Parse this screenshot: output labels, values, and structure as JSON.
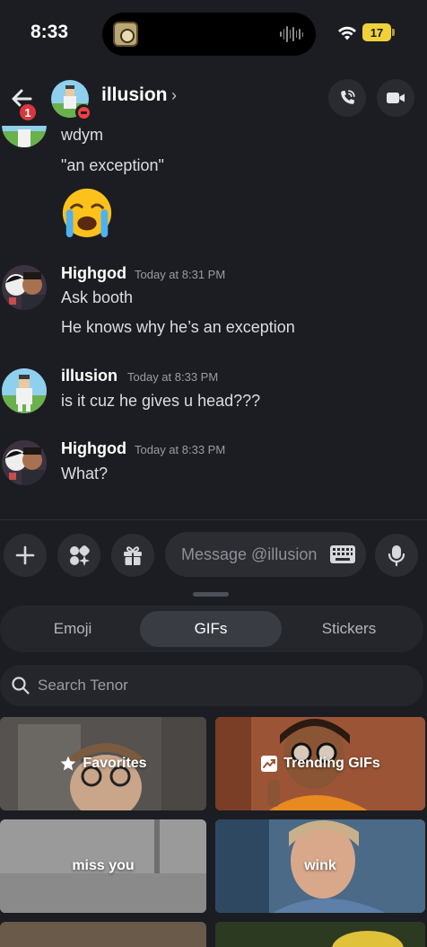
{
  "status_bar": {
    "time": "8:33",
    "battery": "17"
  },
  "header": {
    "title": "illusion",
    "chevron": "›",
    "back_badge": "1"
  },
  "messages": {
    "partial": {
      "line1": "wdym",
      "line2": "\"an exception\""
    },
    "group1": {
      "author": "Highgod",
      "timestamp": "Today at 8:31 PM",
      "line1": "Ask booth",
      "line2": "He knows why he’s an exception"
    },
    "group2": {
      "author": "illusion",
      "timestamp": "Today at 8:33 PM",
      "line1": "is it cuz he gives u head???"
    },
    "group3": {
      "author": "Highgod",
      "timestamp": "Today at 8:33 PM",
      "line1": "What?"
    }
  },
  "composer": {
    "placeholder": "Message @illusion"
  },
  "picker": {
    "tabs": [
      "Emoji",
      "GIFs",
      "Stickers"
    ],
    "active_tab": "GIFs",
    "search_placeholder": "Search Tenor",
    "tiles": [
      "Favorites",
      "Trending GIFs",
      "miss you",
      "wink"
    ]
  },
  "colors": {
    "background": "#1c1d22",
    "surface": "#2b2d33",
    "danger": "#da373c",
    "battery": "#f0d13a"
  }
}
